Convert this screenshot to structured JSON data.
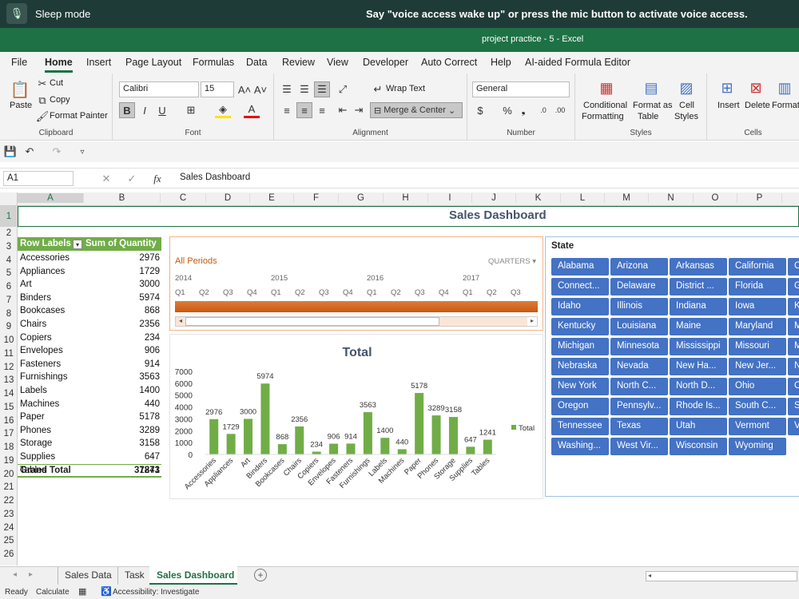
{
  "voice": {
    "mode": "Sleep mode",
    "message": "Say \"voice access wake up\" or press the mic button to activate voice access."
  },
  "title": "project practice - 5  -  Excel",
  "menu": [
    "File",
    "Home",
    "Insert",
    "Page Layout",
    "Formulas",
    "Data",
    "Review",
    "View",
    "Developer",
    "Auto Correct",
    "Help",
    "AI-aided Formula Editor"
  ],
  "ribbon": {
    "paste": "Paste",
    "cut": "Cut",
    "copy": "Copy",
    "format_painter": "Format Painter",
    "clipboard": "Clipboard",
    "font_name": "Calibri",
    "font_size": "15",
    "font": "Font",
    "wrap": "Wrap Text",
    "merge": "Merge & Center",
    "alignment": "Alignment",
    "number_format": "General",
    "number": "Number",
    "cond1": "Conditional",
    "cond2": "Formatting",
    "fmt1": "Format as",
    "fmt2": "Table",
    "cs1": "Cell",
    "cs2": "Styles",
    "styles": "Styles",
    "insert": "Insert",
    "delete": "Delete",
    "format": "Format",
    "cells": "Cells",
    "bold": "B",
    "italic": "I",
    "underline": "U"
  },
  "formula": {
    "namebox": "A1",
    "fx": "fx",
    "content": "Sales Dashboard"
  },
  "columns": [
    "A",
    "B",
    "C",
    "D",
    "E",
    "F",
    "G",
    "H",
    "I",
    "J",
    "K",
    "L",
    "M",
    "N",
    "O",
    "P"
  ],
  "rows": [
    "1",
    "2",
    "3",
    "4",
    "5",
    "6",
    "7",
    "8",
    "9",
    "10",
    "11",
    "12",
    "13",
    "14",
    "15",
    "16",
    "17",
    "18",
    "19",
    "20",
    "21",
    "22",
    "23",
    "24",
    "25",
    "26"
  ],
  "sheet": {
    "title": "Sales Dashboard",
    "header": [
      "Row Labels",
      "Sum of Quantity"
    ],
    "items": [
      [
        "Accessories",
        "2976"
      ],
      [
        "Appliances",
        "1729"
      ],
      [
        "Art",
        "3000"
      ],
      [
        "Binders",
        "5974"
      ],
      [
        "Bookcases",
        "868"
      ],
      [
        "Chairs",
        "2356"
      ],
      [
        "Copiers",
        "234"
      ],
      [
        "Envelopes",
        "906"
      ],
      [
        "Fasteners",
        "914"
      ],
      [
        "Furnishings",
        "3563"
      ],
      [
        "Labels",
        "1400"
      ],
      [
        "Machines",
        "440"
      ],
      [
        "Paper",
        "5178"
      ],
      [
        "Phones",
        "3289"
      ],
      [
        "Storage",
        "3158"
      ],
      [
        "Supplies",
        "647"
      ],
      [
        "Tables",
        "1241"
      ]
    ],
    "total": [
      "Grand Total",
      "37873"
    ]
  },
  "timeline": {
    "caption": "All Periods",
    "level": "QUARTERS",
    "years": [
      "2014",
      "2015",
      "2016",
      "2017"
    ],
    "quarters": [
      "Q1",
      "Q2",
      "Q3",
      "Q4",
      "Q1",
      "Q2",
      "Q3",
      "Q4",
      "Q1",
      "Q2",
      "Q3",
      "Q4",
      "Q1",
      "Q2",
      "Q3"
    ]
  },
  "slicer": {
    "title": "State",
    "states": [
      "Alabama",
      "Arizona",
      "Arkansas",
      "California",
      "Connect...",
      "Delaware",
      "District ...",
      "Florida",
      "Idaho",
      "Illinois",
      "Indiana",
      "Iowa",
      "Kentucky",
      "Louisiana",
      "Maine",
      "Maryland",
      "Michigan",
      "Minnesota",
      "Mississippi",
      "Missouri",
      "Nebraska",
      "Nevada",
      "New Ha...",
      "New Jer...",
      "New York",
      "North C...",
      "North D...",
      "Ohio",
      "Oregon",
      "Pennsylv...",
      "Rhode Is...",
      "South C...",
      "Tennessee",
      "Texas",
      "Utah",
      "Vermont",
      "Washing...",
      "West Vir...",
      "Wisconsin",
      "Wyoming"
    ],
    "partial": [
      "C",
      "G",
      "K",
      "M",
      "M",
      "N",
      "O",
      "S",
      "V"
    ]
  },
  "chart_data": {
    "type": "bar",
    "title": "Total",
    "categories": [
      "Accessories",
      "Appliances",
      "Art",
      "Binders",
      "Bookcases",
      "Chairs",
      "Copiers",
      "Envelopes",
      "Fasteners",
      "Furnishings",
      "Labels",
      "Machines",
      "Paper",
      "Phones",
      "Storage",
      "Supplies",
      "Tables"
    ],
    "series": [
      {
        "name": "Total",
        "values": [
          2976,
          1729,
          3000,
          5974,
          868,
          2356,
          234,
          906,
          914,
          3563,
          1400,
          440,
          5178,
          3289,
          3158,
          647,
          1241
        ]
      }
    ],
    "yticks": [
      "0",
      "1000",
      "2000",
      "3000",
      "4000",
      "5000",
      "6000",
      "7000"
    ],
    "ylim": [
      0,
      7000
    ],
    "legend": "right",
    "color": "#70ad47"
  },
  "tabs": [
    "Sales Data",
    "Task",
    "Sales Dashboard"
  ],
  "status": {
    "ready": "Ready",
    "calc": "Calculate",
    "access": "Accessibility: Investigate"
  },
  "colors": {
    "excel_green": "#1e7145",
    "tile_blue": "#4472c4",
    "timeline_orange": "#c55a11",
    "pivot_header": "#70ad47"
  }
}
